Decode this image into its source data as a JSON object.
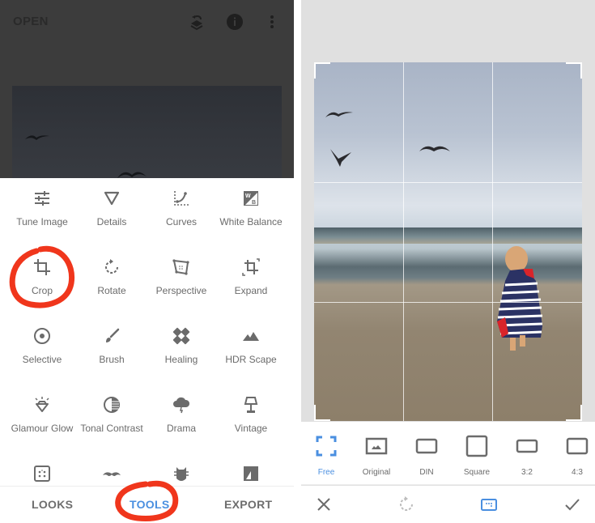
{
  "left_screen": {
    "header": {
      "open_label": "OPEN",
      "icons": [
        "layers-undo-icon",
        "info-icon",
        "more-vert-icon"
      ]
    },
    "tools": [
      {
        "label": "Tune Image",
        "icon": "sliders-icon"
      },
      {
        "label": "Details",
        "icon": "triangle-icon"
      },
      {
        "label": "Curves",
        "icon": "curves-icon"
      },
      {
        "label": "White Balance",
        "icon": "white-balance-icon"
      },
      {
        "label": "Crop",
        "icon": "crop-icon"
      },
      {
        "label": "Rotate",
        "icon": "rotate-icon"
      },
      {
        "label": "Perspective",
        "icon": "perspective-icon"
      },
      {
        "label": "Expand",
        "icon": "expand-icon"
      },
      {
        "label": "Selective",
        "icon": "selective-icon"
      },
      {
        "label": "Brush",
        "icon": "brush-icon"
      },
      {
        "label": "Healing",
        "icon": "healing-icon"
      },
      {
        "label": "HDR Scape",
        "icon": "mountain-icon"
      },
      {
        "label": "Glamour Glow",
        "icon": "diamond-glow-icon"
      },
      {
        "label": "Tonal Contrast",
        "icon": "tonal-contrast-icon"
      },
      {
        "label": "Drama",
        "icon": "cloud-lightning-icon"
      },
      {
        "label": "Vintage",
        "icon": "lamp-icon"
      },
      {
        "label": "",
        "icon": "grainy-film-icon"
      },
      {
        "label": "",
        "icon": "mustache-icon"
      },
      {
        "label": "",
        "icon": "grunge-icon"
      },
      {
        "label": "",
        "icon": "black-white-icon"
      }
    ],
    "bottom_nav": {
      "looks": "LOOKS",
      "tools": "TOOLS",
      "export": "EXPORT",
      "active": "TOOLS"
    },
    "annotations": [
      "Crop",
      "TOOLS"
    ]
  },
  "right_screen": {
    "aspect_ratios": [
      {
        "label": "Free",
        "icon": "free-crop-icon",
        "active": true
      },
      {
        "label": "Original",
        "icon": "original-image-icon",
        "active": false
      },
      {
        "label": "DIN",
        "icon": "din-ratio-icon",
        "active": false
      },
      {
        "label": "Square",
        "icon": "square-ratio-icon",
        "active": false
      },
      {
        "label": "3:2",
        "icon": "ratio-3-2-icon",
        "active": false
      },
      {
        "label": "4:3",
        "icon": "ratio-4-3-icon",
        "active": false
      }
    ],
    "actions": {
      "cancel": "close-icon",
      "rotate": "rotate-icon",
      "aspect": "aspect-ratio-icon",
      "apply": "check-icon"
    }
  },
  "colors": {
    "accent": "#4a8fe0",
    "annotation": "#f0361c",
    "icon_gray": "#6b6b6b",
    "dim_overlay": "#3c3c3c",
    "right_bg": "#e0e0e0"
  }
}
